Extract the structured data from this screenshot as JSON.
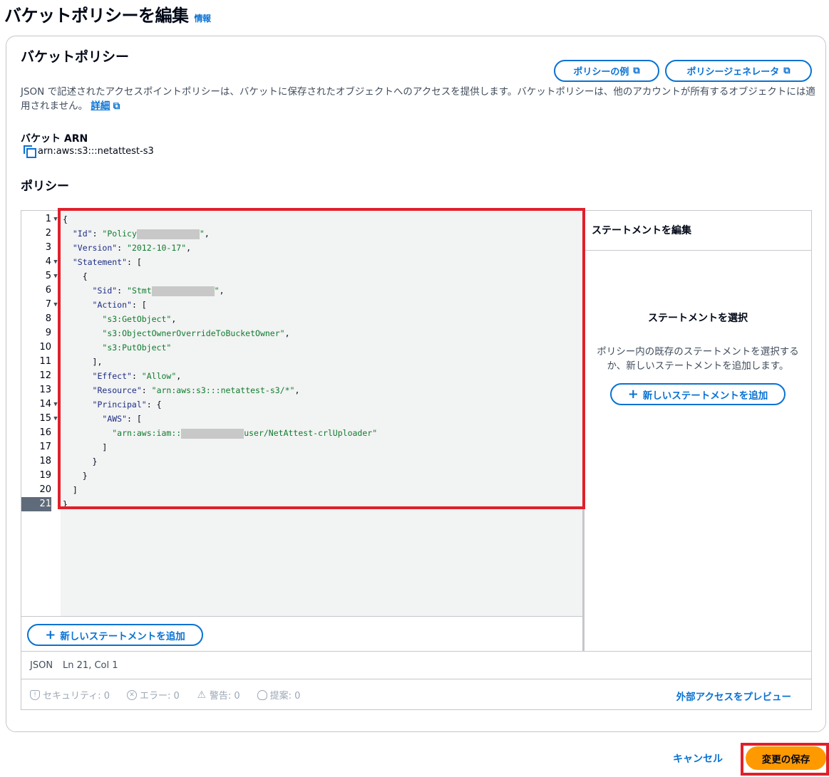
{
  "header": {
    "title": "バケットポリシーを編集",
    "info": "情報"
  },
  "section": {
    "title": "バケットポリシー",
    "policy_examples_label": "ポリシーの例",
    "policy_generator_label": "ポリシージェネレータ",
    "description": "JSON で記述されたアクセスポイントポリシーは、バケットに保存されたオブジェクトへのアクセスを提供します。バケットポリシーは、他のアカウントが所有するオブジェクトには適用されません。",
    "details_link": "詳細",
    "arn_label": "バケット ARN",
    "arn_value": "arn:aws:s3:::netattest-s3",
    "policy_label": "ポリシー"
  },
  "editor": {
    "lines": [
      {
        "n": "1",
        "fold": true
      },
      {
        "n": "2",
        "fold": false
      },
      {
        "n": "3",
        "fold": false
      },
      {
        "n": "4",
        "fold": true
      },
      {
        "n": "5",
        "fold": true
      },
      {
        "n": "6",
        "fold": false
      },
      {
        "n": "7",
        "fold": true
      },
      {
        "n": "8",
        "fold": false
      },
      {
        "n": "9",
        "fold": false
      },
      {
        "n": "10",
        "fold": false
      },
      {
        "n": "11",
        "fold": false
      },
      {
        "n": "12",
        "fold": false
      },
      {
        "n": "13",
        "fold": false
      },
      {
        "n": "14",
        "fold": true
      },
      {
        "n": "15",
        "fold": true
      },
      {
        "n": "16",
        "fold": false
      },
      {
        "n": "17",
        "fold": false
      },
      {
        "n": "18",
        "fold": false
      },
      {
        "n": "19",
        "fold": false
      },
      {
        "n": "20",
        "fold": false
      },
      {
        "n": "21",
        "fold": false
      }
    ],
    "code": {
      "l1": "{",
      "l2_key": "\"Id\"",
      "l2_val_prefix": "\"Policy",
      "l2_val_suffix": "\"",
      "l3_key": "\"Version\"",
      "l3_val": "\"2012-10-17\"",
      "l4_key": "\"Statement\"",
      "l5": "{",
      "l6_key": "\"Sid\"",
      "l6_val_prefix": "\"Stmt",
      "l6_val_suffix": "\"",
      "l7_key": "\"Action\"",
      "l8_val": "\"s3:GetObject\"",
      "l9_val": "\"s3:ObjectOwnerOverrideToBucketOwner\"",
      "l10_val": "\"s3:PutObject\"",
      "l11": "],",
      "l12_key": "\"Effect\"",
      "l12_val": "\"Allow\"",
      "l13_key": "\"Resource\"",
      "l13_val": "\"arn:aws:s3:::netattest-s3/*\"",
      "l14_key": "\"Principal\"",
      "l15_key": "\"AWS\"",
      "l16_val_prefix": "\"arn:aws:iam::",
      "l16_val_suffix": "user/NetAttest-crlUploader\"",
      "l17": "]",
      "l18": "}",
      "l19": "}",
      "l20": "]",
      "l21": "}"
    },
    "add_statement_label": "新しいステートメントを追加"
  },
  "side_panel": {
    "header": "ステートメントを編集",
    "title": "ステートメントを選択",
    "description": "ポリシー内の既存のステートメントを選択するか、新しいステートメントを追加します。",
    "add_statement_label": "新しいステートメントを追加"
  },
  "status": {
    "lang": "JSON",
    "position": "Ln 21, Col 1"
  },
  "validation": {
    "security": "セキュリティ: 0",
    "errors": "エラー: 0",
    "warnings": "警告: 0",
    "suggestions": "提案: 0",
    "preview_link": "外部アクセスをプレビュー"
  },
  "footer": {
    "cancel": "キャンセル",
    "save": "変更の保存"
  },
  "colors": {
    "accent": "#0972d3",
    "primary_button": "#ff9900",
    "highlight": "#e0202b"
  }
}
